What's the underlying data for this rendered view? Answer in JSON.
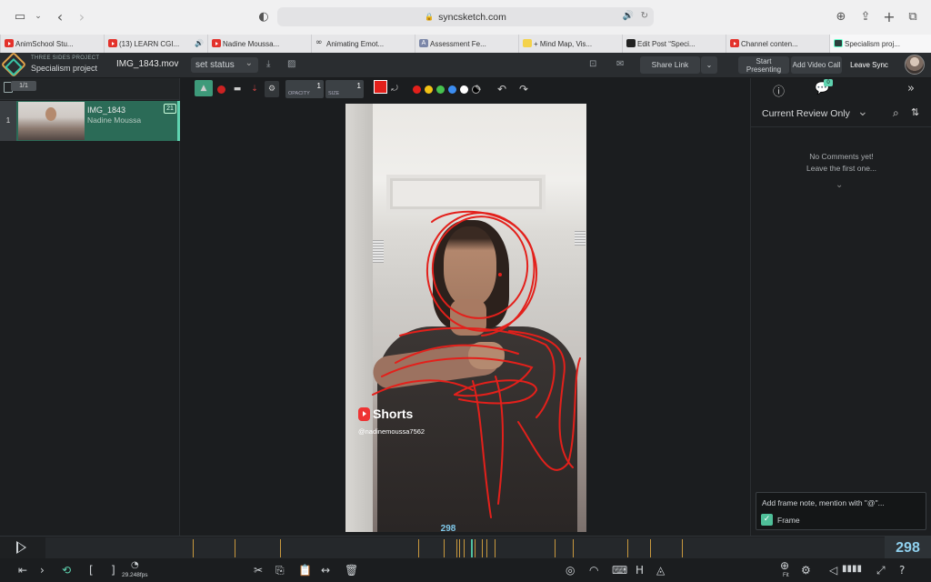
{
  "browser": {
    "url": "syncsketch.com",
    "tabs": [
      {
        "label": "AnimSchool Stu...",
        "fav": "yt"
      },
      {
        "label": "(13) LEARN CGI...",
        "fav": "yt",
        "sound": true
      },
      {
        "label": "Nadine Moussa...",
        "fav": "yt"
      },
      {
        "label": "Animating Emot...",
        "fav": "x"
      },
      {
        "label": "Assessment Fe...",
        "fav": "a"
      },
      {
        "label": "+ Mind Map, Vis...",
        "fav": "y"
      },
      {
        "label": "Edit Post “Speci...",
        "fav": "e"
      },
      {
        "label": "Channel conten...",
        "fav": "yt"
      },
      {
        "label": "Specialism proj...",
        "fav": "s",
        "active": true
      }
    ]
  },
  "header": {
    "project_group": "THREE SIDES PROJECT",
    "project": "Specialism project",
    "file_name": "IMG_1843.mov",
    "set_status": "set status",
    "share_link": "Share Link",
    "start_presenting": "Start Presenting",
    "add_video_call": "Add Video Call",
    "leave_sync": "Leave Sync"
  },
  "sidebar": {
    "count": "1/1",
    "items": [
      {
        "index": "1",
        "title": "IMG_1843",
        "author": "Nadine Moussa",
        "comments": "21"
      }
    ]
  },
  "draw": {
    "opacity_label": "OPACITY",
    "opacity_value": "1",
    "size_label": "SIZE",
    "size_value": "1",
    "active_color": "#e3201b",
    "palette": [
      "#e3201b",
      "#f3c316",
      "#47c24f",
      "#3c8df0",
      "#ffffff",
      "#000000"
    ]
  },
  "video": {
    "shorts_label": "Shorts",
    "handle": "@nadinemoussa7562",
    "frame_overlay": "298"
  },
  "comments": {
    "badge": "0",
    "filter": "Current Review Only",
    "empty_line1": "No Comments yet!",
    "empty_line2": "Leave the first one...",
    "note_placeholder": "Add frame note, mention with \"@\"...",
    "frame_label": "Frame"
  },
  "timeline": {
    "current_frame": "298",
    "fps": "29.248fps",
    "fit_label": "Fit"
  }
}
